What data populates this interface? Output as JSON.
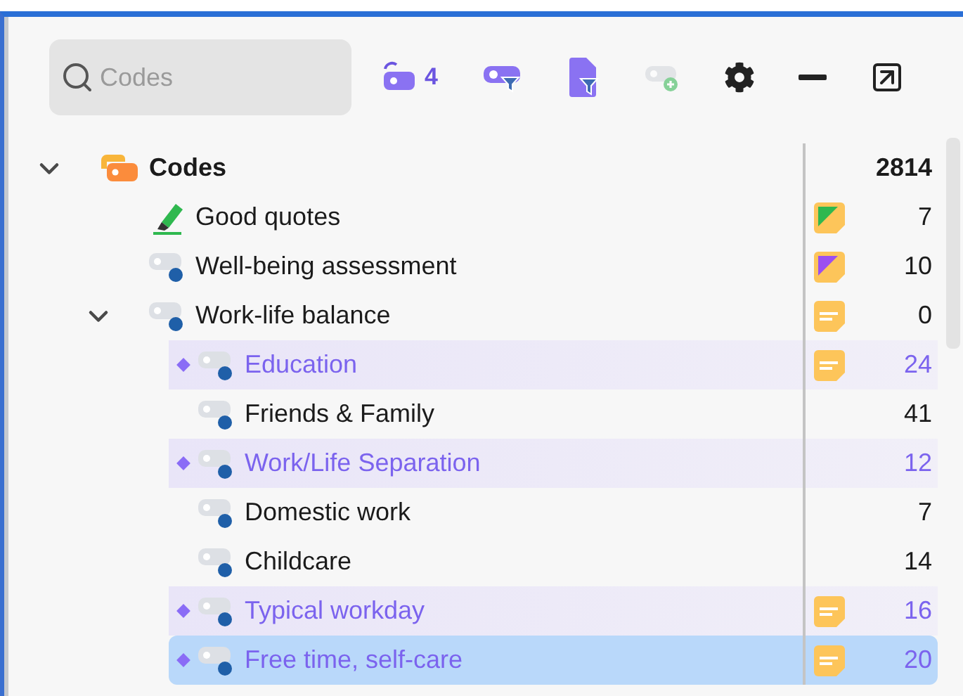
{
  "search": {
    "placeholder": "Codes"
  },
  "toolbar": [
    {
      "kind": "code-history",
      "badge": "4",
      "disabled": false
    },
    {
      "kind": "code-filter",
      "disabled": false
    },
    {
      "kind": "document-filter",
      "disabled": false
    },
    {
      "kind": "new-code",
      "disabled": true
    },
    {
      "kind": "settings",
      "disabled": false
    },
    {
      "kind": "minimize",
      "disabled": false
    },
    {
      "kind": "pop-out",
      "disabled": false
    }
  ],
  "tree": [
    {
      "label": "Codes",
      "kind": "folder",
      "count": "2814",
      "expanded": true,
      "highlighted": false,
      "selected": false,
      "children": [
        {
          "label": "Good quotes",
          "kind": "marker",
          "count": "7",
          "highlighted": false,
          "selected": false,
          "memo": {
            "kind": "corner",
            "color": "#2fb84f"
          }
        },
        {
          "label": "Well-being assessment",
          "kind": "code",
          "count": "10",
          "highlighted": false,
          "selected": false,
          "memo": {
            "kind": "corner",
            "color": "#9b4ff0"
          }
        },
        {
          "label": "Work-life balance",
          "kind": "code",
          "count": "0",
          "expanded": true,
          "highlighted": false,
          "selected": false,
          "memo": {
            "kind": "lines"
          },
          "children": [
            {
              "label": "Education",
              "kind": "code",
              "count": "24",
              "highlighted": true,
              "selected": false,
              "memo": {
                "kind": "lines"
              }
            },
            {
              "label": "Friends & Family",
              "kind": "code",
              "count": "41",
              "highlighted": false,
              "selected": false
            },
            {
              "label": "Work/Life Separation",
              "kind": "code",
              "count": "12",
              "highlighted": true,
              "selected": false
            },
            {
              "label": "Domestic work",
              "kind": "code",
              "count": "7",
              "highlighted": false,
              "selected": false
            },
            {
              "label": "Childcare",
              "kind": "code",
              "count": "14",
              "highlighted": false,
              "selected": false
            },
            {
              "label": "Typical workday",
              "kind": "code",
              "count": "16",
              "highlighted": true,
              "selected": false,
              "memo": {
                "kind": "lines"
              }
            },
            {
              "label": "Free time, self-care",
              "kind": "code",
              "count": "20",
              "highlighted": true,
              "selected": true,
              "memo": {
                "kind": "lines"
              }
            }
          ]
        }
      ]
    }
  ]
}
